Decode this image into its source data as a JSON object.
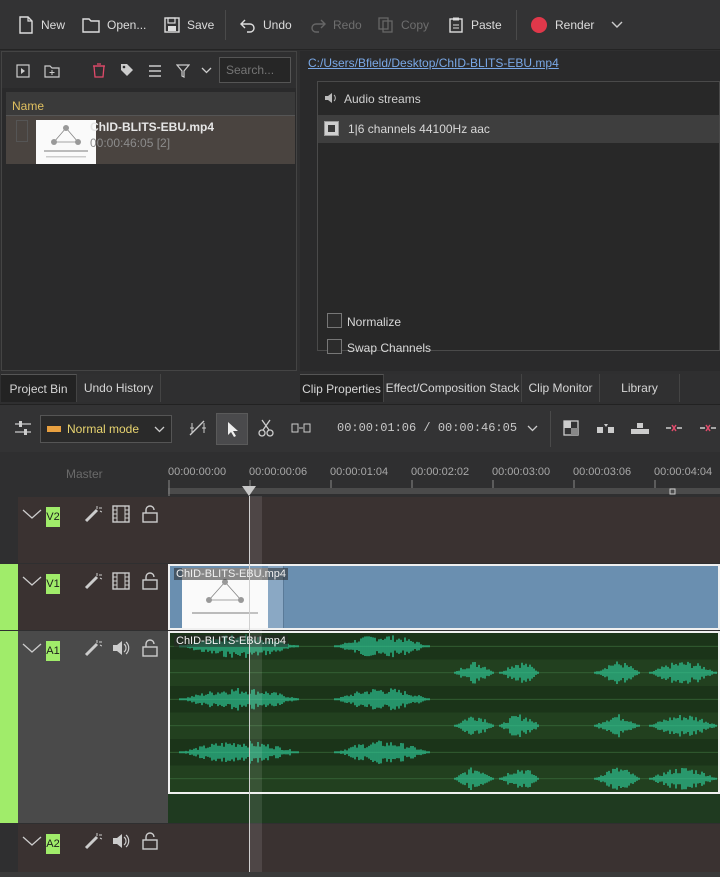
{
  "toolbar": {
    "new": "New",
    "open": "Open...",
    "save": "Save",
    "undo": "Undo",
    "redo": "Redo",
    "copy": "Copy",
    "paste": "Paste",
    "render": "Render",
    "render_color": "#e0384a"
  },
  "bin": {
    "search_placeholder": "Search...",
    "column_name": "Name",
    "clip": {
      "name": "ChID-BLITS-EBU.mp4",
      "duration": "00:00:46:05 [2]"
    }
  },
  "properties": {
    "path": "C:/Users/Bfield/Desktop/ChID-BLITS-EBU.mp4",
    "audio_streams_label": "Audio streams",
    "stream": "1|6 channels 44100Hz aac",
    "normalize": "Normalize",
    "swap_channels": "Swap Channels"
  },
  "tabs_left": [
    "Project Bin",
    "Undo History"
  ],
  "tabs_right": [
    "Clip Properties",
    "Effect/Composition Stack",
    "Clip Monitor",
    "Library"
  ],
  "timeline": {
    "mode": "Normal mode",
    "timecode": "00:00:01:06 / 00:00:46:05",
    "master_label": "Master",
    "ruler": [
      "00:00:00:00",
      "00:00:00:06",
      "00:00:01:04",
      "00:00:02:02",
      "00:00:03:00",
      "00:00:03:06",
      "00:00:04:04"
    ],
    "tracks": [
      {
        "label": "V2"
      },
      {
        "label": "V1",
        "clip": "ChID-BLITS-EBU.mp4"
      },
      {
        "label": "A1",
        "clip": "ChID-BLITS-EBU.mp4"
      },
      {
        "label": "A2"
      }
    ],
    "track_active_color": "#a0ec6a",
    "waveform_color": "#2ed3a0"
  }
}
